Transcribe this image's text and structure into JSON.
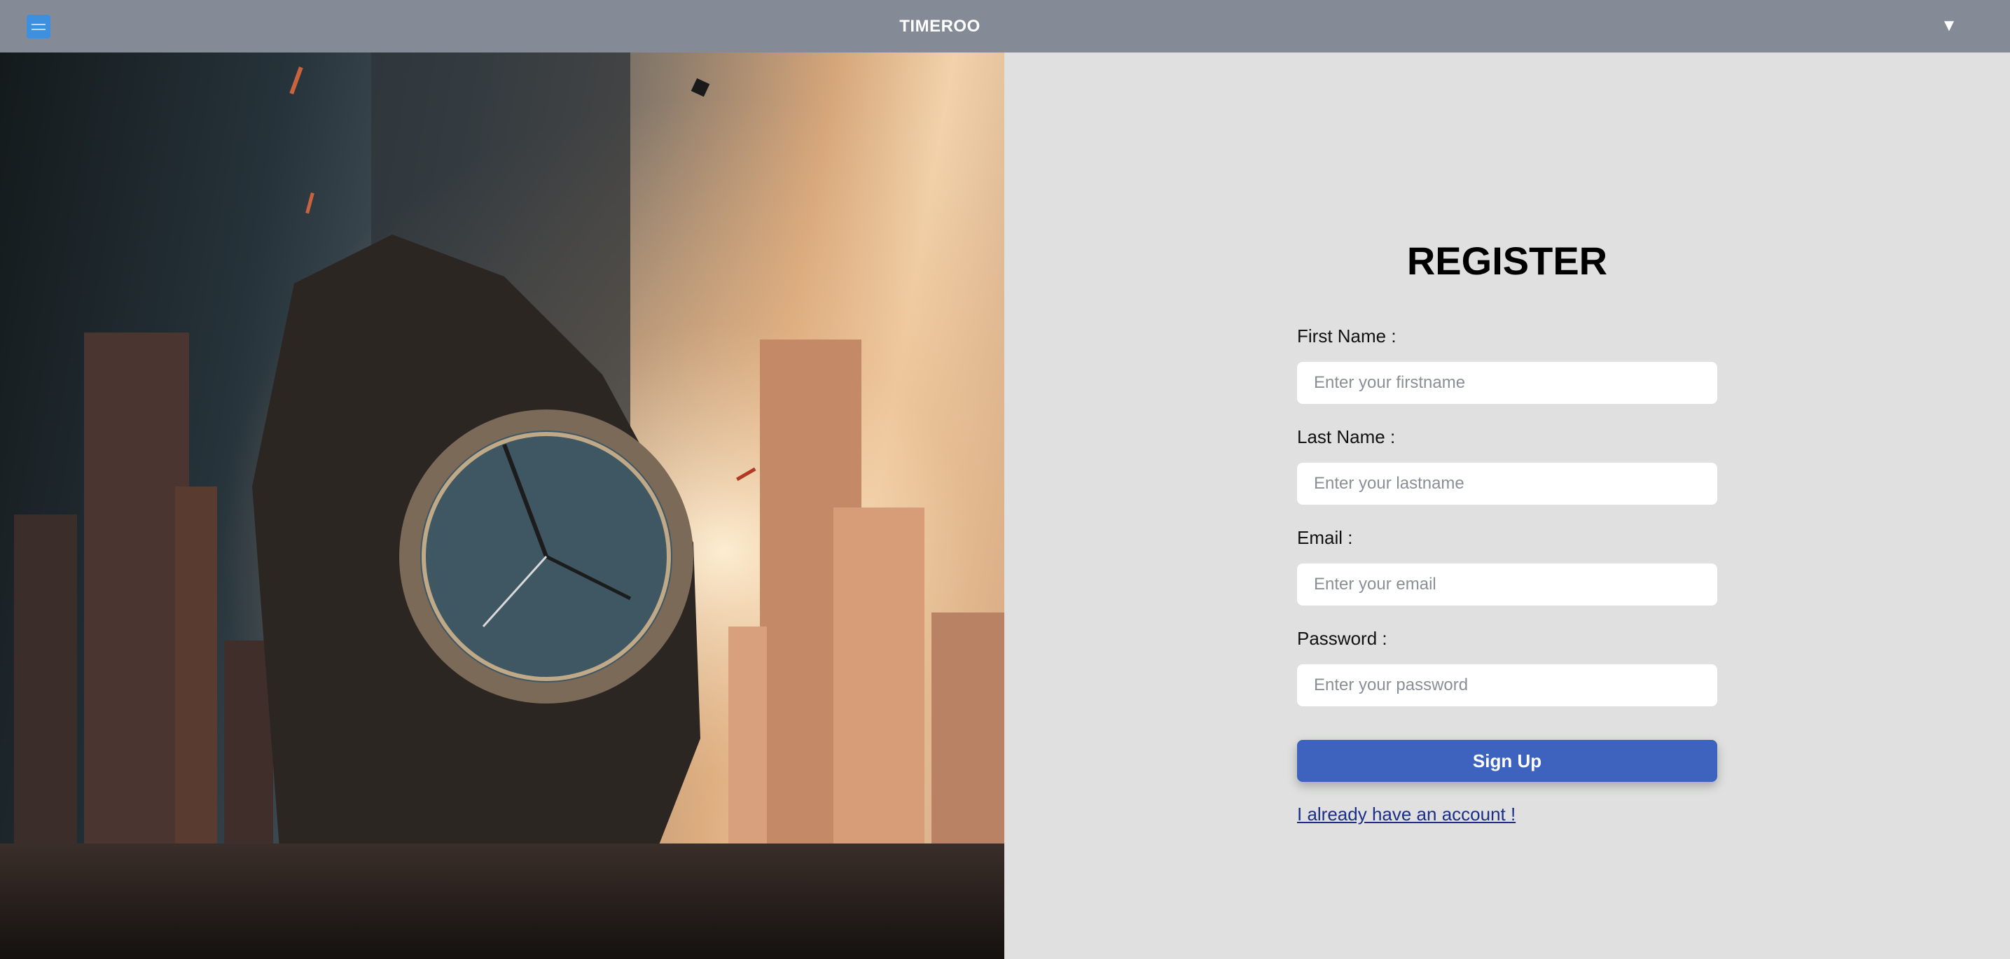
{
  "header": {
    "brand": "TIMEROO",
    "menu_icon": "hamburger-menu-icon",
    "dropdown_icon": "dropdown-triangle-icon",
    "dropdown_glyph": "▼"
  },
  "hero": {
    "image_subject": "ruined giant clock among city skyscrapers at sunset"
  },
  "form": {
    "title": "REGISTER",
    "fields": [
      {
        "label": "First Name :",
        "placeholder": "Enter your firstname",
        "value": ""
      },
      {
        "label": "Last Name :",
        "placeholder": "Enter your lastname",
        "value": ""
      },
      {
        "label": "Email :",
        "placeholder": "Enter your email",
        "value": ""
      },
      {
        "label": "Password :",
        "placeholder": "Enter your password",
        "value": ""
      }
    ],
    "submit_label": "Sign Up",
    "login_link": "I already have an account !"
  },
  "colors": {
    "topbar": "#848a96",
    "panel": "#dfe0df",
    "button": "#3d63bf",
    "link": "#1b2f8a",
    "menu_button": "#3d8fe0"
  }
}
